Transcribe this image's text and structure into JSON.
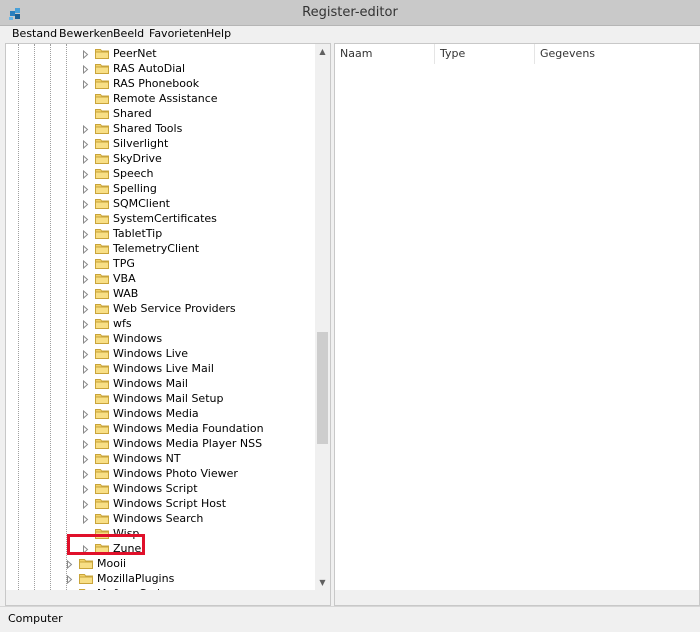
{
  "window": {
    "title": "Register-editor"
  },
  "menu": [
    {
      "label": "Bestand"
    },
    {
      "label": "Bewerken"
    },
    {
      "label": "Beeld"
    },
    {
      "label": "Favorieten"
    },
    {
      "label": "Help"
    }
  ],
  "tree": {
    "subkeys": [
      "PeerNet",
      "RAS AutoDial",
      "RAS Phonebook",
      "Remote Assistance",
      "Shared",
      "Shared Tools",
      "Silverlight",
      "SkyDrive",
      "Speech",
      "Spelling",
      "SQMClient",
      "SystemCertificates",
      "TabletTip",
      "TelemetryClient",
      "TPG",
      "VBA",
      "WAB",
      "Web Service Providers",
      "wfs",
      "Windows",
      "Windows Live",
      "Windows Live Mail",
      "Windows Mail",
      "Windows Mail Setup",
      "Windows Media",
      "Windows Media Foundation",
      "Windows Media Player NSS",
      "Windows NT",
      "Windows Photo Viewer",
      "Windows Script",
      "Windows Script Host",
      "Windows Search",
      "Wisp",
      "Zune"
    ],
    "topkeys": [
      "Mooii",
      "MozillaPlugins",
      "Mufree Codec"
    ]
  },
  "list": {
    "columns": [
      "Naam",
      "Type",
      "Gegevens"
    ]
  },
  "status": {
    "path": "Computer"
  }
}
